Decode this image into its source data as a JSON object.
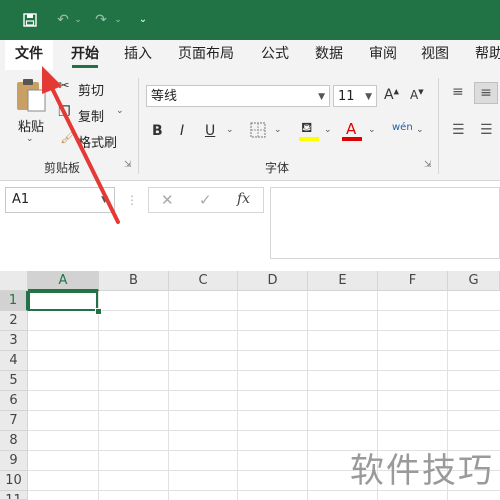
{
  "titlebar": {
    "save_icon": "save-icon",
    "undo_icon": "undo-icon",
    "redo_icon": "redo-icon",
    "customize_icon": "customize-qat-icon"
  },
  "tabs": [
    "文件",
    "开始",
    "插入",
    "页面布局",
    "公式",
    "数据",
    "审阅",
    "视图",
    "帮助"
  ],
  "ribbon": {
    "clipboard": {
      "paste_label": "粘贴",
      "cut_label": "剪切",
      "copy_label": "复制",
      "format_painter_label": "格式刷",
      "group_label": "剪贴板"
    },
    "font": {
      "font_name": "等线",
      "font_size": "11",
      "bold": "B",
      "italic": "I",
      "underline": "U",
      "grow_font": "A",
      "shrink_font": "A",
      "font_color": "A",
      "phonetic": "wén",
      "group_label": "字体"
    }
  },
  "formula_bar": {
    "name_box": "A1",
    "fx_label": "fx"
  },
  "grid": {
    "columns": [
      "A",
      "B",
      "C",
      "D",
      "E",
      "F",
      "G"
    ],
    "rows": [
      "1",
      "2",
      "3",
      "4",
      "5",
      "6",
      "7",
      "8",
      "9",
      "10",
      "11"
    ],
    "selected_cell": "A1"
  },
  "watermark": "软件技巧",
  "colors": {
    "brand": "#217346",
    "arrow": "#e53935",
    "highlight_yellow": "#ffff00",
    "font_red": "#e00000"
  }
}
